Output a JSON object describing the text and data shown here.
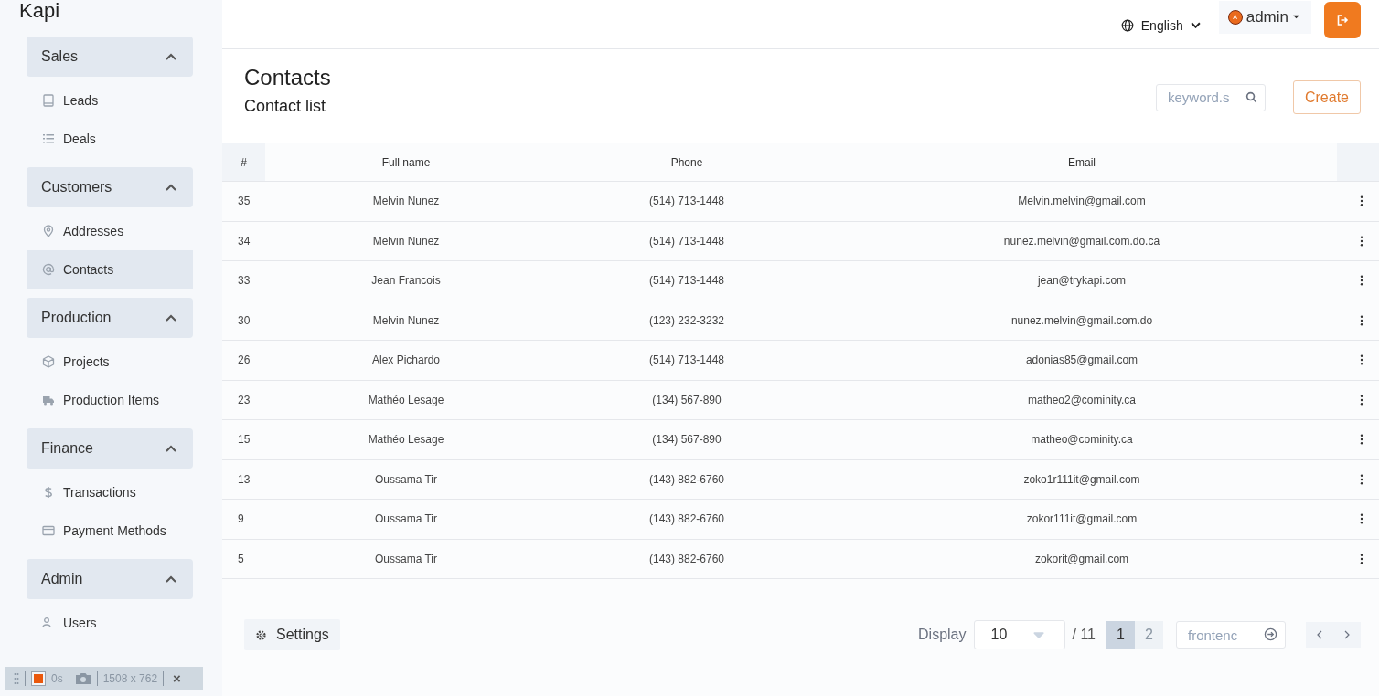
{
  "logo": "Kapi",
  "sidebar": {
    "groups": [
      {
        "title": "Sales",
        "expanded": true,
        "items": [
          {
            "label": "Leads",
            "selected": false
          },
          {
            "label": "Deals",
            "selected": false
          }
        ]
      },
      {
        "title": "Customers",
        "expanded": true,
        "items": [
          {
            "label": "Addresses",
            "selected": false
          },
          {
            "label": "Contacts",
            "selected": true
          }
        ]
      },
      {
        "title": "Production",
        "expanded": true,
        "items": [
          {
            "label": "Projects",
            "selected": false
          },
          {
            "label": "Production Items",
            "selected": false
          }
        ]
      },
      {
        "title": "Finance",
        "expanded": true,
        "items": [
          {
            "label": "Transactions",
            "selected": false
          },
          {
            "label": "Payment Methods",
            "selected": false
          }
        ]
      },
      {
        "title": "Admin",
        "expanded": true,
        "items": [
          {
            "label": "Users",
            "selected": false
          }
        ]
      }
    ]
  },
  "topbar": {
    "language": "English",
    "user": "admin",
    "avatar_letter": "A"
  },
  "page": {
    "title": "Contacts",
    "subtitle": "Contact list",
    "search_placeholder": "keyword.s",
    "create": "Create"
  },
  "table": {
    "columns": [
      "#",
      "Full name",
      "Phone",
      "Email"
    ],
    "rows": [
      [
        "35",
        "Melvin Nunez",
        "(514) 713-1448",
        "Melvin.melvin@gmail.com"
      ],
      [
        "34",
        "Melvin Nunez",
        "(514) 713-1448",
        "nunez.melvin@gmail.com.do.ca"
      ],
      [
        "33",
        "Jean Francois",
        "(514) 713-1448",
        "jean@trykapi.com"
      ],
      [
        "30",
        "Melvin Nunez",
        "(123) 232-3232",
        "nunez.melvin@gmail.com.do"
      ],
      [
        "26",
        "Alex Pichardo",
        "(514) 713-1448",
        "adonias85@gmail.com"
      ],
      [
        "23",
        "Mathéo Lesage",
        "(134) 567-890",
        "matheo2@cominity.ca"
      ],
      [
        "15",
        "Mathéo Lesage",
        "(134) 567-890",
        "matheo@cominity.ca"
      ],
      [
        "13",
        "Oussama Tir",
        "(143) 882-6760",
        "zoko1r111it@gmail.com"
      ],
      [
        "9",
        "Oussama Tir",
        "(143) 882-6760",
        "zokor111it@gmail.com"
      ],
      [
        "5",
        "Oussama Tir",
        "(143) 882-6760",
        "zokorit@gmail.com"
      ]
    ]
  },
  "footer": {
    "settings": "Settings",
    "display_label": "Display",
    "page_size": "10",
    "total_pages": "/ 11",
    "pages": [
      {
        "label": "1",
        "selected": true
      },
      {
        "label": "2",
        "selected": false
      }
    ],
    "goto_placeholder": "frontenc"
  },
  "recorder": {
    "time": "0s",
    "size": "1508 x 762",
    "close": "×"
  }
}
